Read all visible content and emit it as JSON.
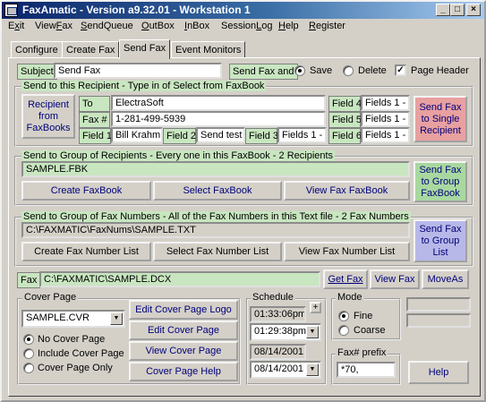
{
  "window": {
    "title": "FaxAmatic - Version a9.32.01 - Workstation 1",
    "minimize": "_",
    "maximize": "□",
    "close": "×"
  },
  "menu": [
    {
      "pre": "E",
      "ul": "x",
      "post": "it"
    },
    {
      "pre": "View",
      "ul": "F",
      "post": "ax"
    },
    {
      "pre": "",
      "ul": "S",
      "post": "endQueue"
    },
    {
      "pre": "",
      "ul": "O",
      "post": "utBox"
    },
    {
      "pre": "",
      "ul": "I",
      "post": "nBox"
    },
    {
      "pre": "Session",
      "ul": "L",
      "post": "og"
    },
    {
      "pre": "",
      "ul": "H",
      "post": "elp"
    },
    {
      "pre": "",
      "ul": "R",
      "post": "egister"
    }
  ],
  "tabs": [
    "Configure",
    "Create Fax",
    "Send Fax",
    "Event Monitors"
  ],
  "active_tab": "Send Fax",
  "subject": {
    "label": "Subject",
    "value": "Send Fax",
    "send_and_label": "Send Fax and",
    "save_label": "Save",
    "delete_label": "Delete",
    "page_header_label": "Page Header",
    "page_header_checked": true
  },
  "recipient": {
    "group_title": "Send to this Recipient - Type in of Select from FaxBook",
    "from_faxbooks_button": "Recipient from FaxBooks",
    "to_label": "To",
    "to_value": "ElectraSoft",
    "faxno_label": "Fax #",
    "faxno_value": "1-281-499-5939",
    "field1_label": "Field 1",
    "field1_value": "Bill Krahm",
    "field2_label": "Field 2",
    "field2_value": "Send test",
    "field3_label": "Field 3",
    "field3_value": "Fields 1 -",
    "field4_label": "Field 4",
    "field4_value": "Fields 1 -",
    "field5_label": "Field 5",
    "field5_value": "Fields 1 -",
    "field6_label": "Field 6",
    "field6_value": "Fields 1 -",
    "send_button": "Send Fax to Single Recipient"
  },
  "group_recipients": {
    "group_title": "Send to Group of Recipients - Every one in this FaxBook - 2 Recipients",
    "faxbook_value": "SAMPLE.FBK",
    "create_button": "Create FaxBook",
    "select_button": "Select FaxBook",
    "view_button": "View Fax FaxBook",
    "send_button": "Send Fax to Group FaxBook"
  },
  "group_numbers": {
    "group_title": "Send to Group of Fax Numbers - All of the Fax Numbers in this Text file - 2 Fax Numbers",
    "file_value": "C:\\FAXMATIC\\FaxNums\\SAMPLE.TXT",
    "create_button": "Create Fax Number List",
    "select_button": "Select Fax Number List",
    "view_button": "View Fax Number List",
    "send_button": "Send Fax to Group List"
  },
  "fax_file": {
    "label": "Fax",
    "value": "C:\\FAXMATIC\\SAMPLE.DCX",
    "get_button": "Get Fax",
    "view_button": "View Fax",
    "move_button": "MoveAs"
  },
  "cover_page": {
    "title": "Cover Page",
    "selected": "SAMPLE.CVR",
    "edit_logo_button": "Edit Cover Page Logo",
    "edit_button": "Edit Cover Page",
    "view_button": "View Cover Page",
    "help_button": "Cover Page Help",
    "option_none": "No Cover Page",
    "option_include": "Include Cover Page",
    "option_only": "Cover Page Only"
  },
  "schedule": {
    "title": "Schedule",
    "time_display": "01:33:06pm",
    "time_value": "01:29:38pm",
    "date_display": "08/14/2001",
    "date_value": "08/14/2001",
    "plus": "+"
  },
  "mode": {
    "title": "Mode",
    "fine_label": "Fine",
    "coarse_label": "Coarse"
  },
  "prefix": {
    "title": "Fax# prefix",
    "value": "*70,"
  },
  "help_button": "Help"
}
